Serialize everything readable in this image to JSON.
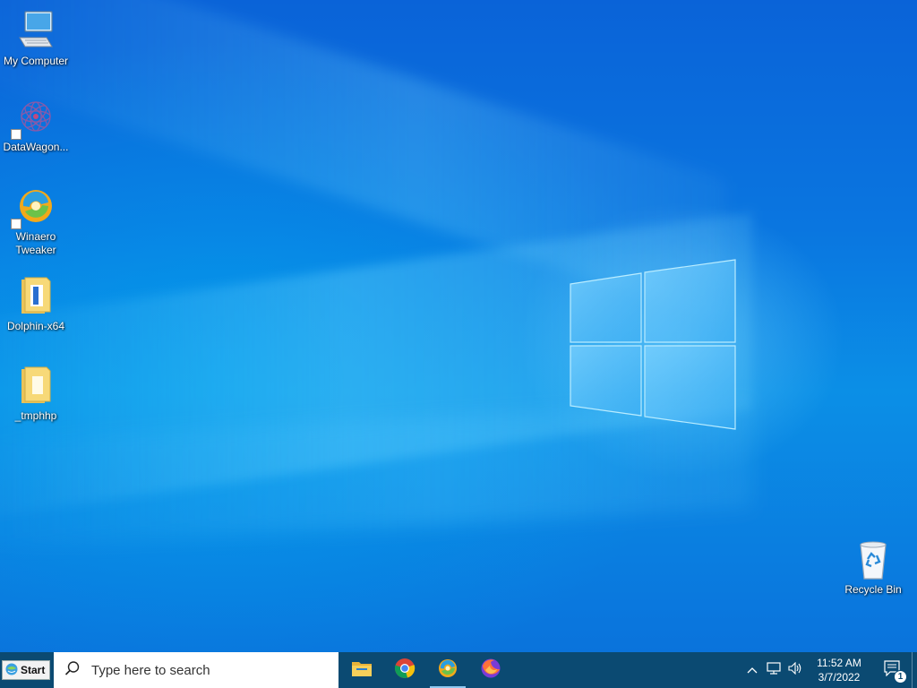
{
  "desktop": {
    "icons": [
      {
        "label": "My Computer",
        "icon": "monitor-icon"
      },
      {
        "label": "DataWagon...",
        "icon": "datawagon-icon"
      },
      {
        "label": "Winaero Tweaker",
        "icon": "winaero-icon"
      },
      {
        "label": "Dolphin-x64",
        "icon": "folder-icon"
      },
      {
        "label": "_tmphhp",
        "icon": "folder-icon"
      }
    ],
    "recycle_bin": {
      "label": "Recycle Bin",
      "icon": "recycle-bin-icon"
    }
  },
  "taskbar": {
    "start_label": "Start",
    "search_placeholder": "Type here to search",
    "apps": [
      {
        "name": "File Explorer",
        "icon": "file-explorer-icon"
      },
      {
        "name": "Google Chrome",
        "icon": "chrome-icon"
      },
      {
        "name": "Winaero Tweaker",
        "icon": "winaero-icon",
        "active": true
      },
      {
        "name": "Firefox",
        "icon": "firefox-icon"
      }
    ],
    "clock": {
      "time": "11:52 AM",
      "date": "3/7/2022"
    },
    "notifications_count": "1"
  },
  "colors": {
    "taskbar": "#0b4a72",
    "desktop_blue": "#0a76e0"
  }
}
